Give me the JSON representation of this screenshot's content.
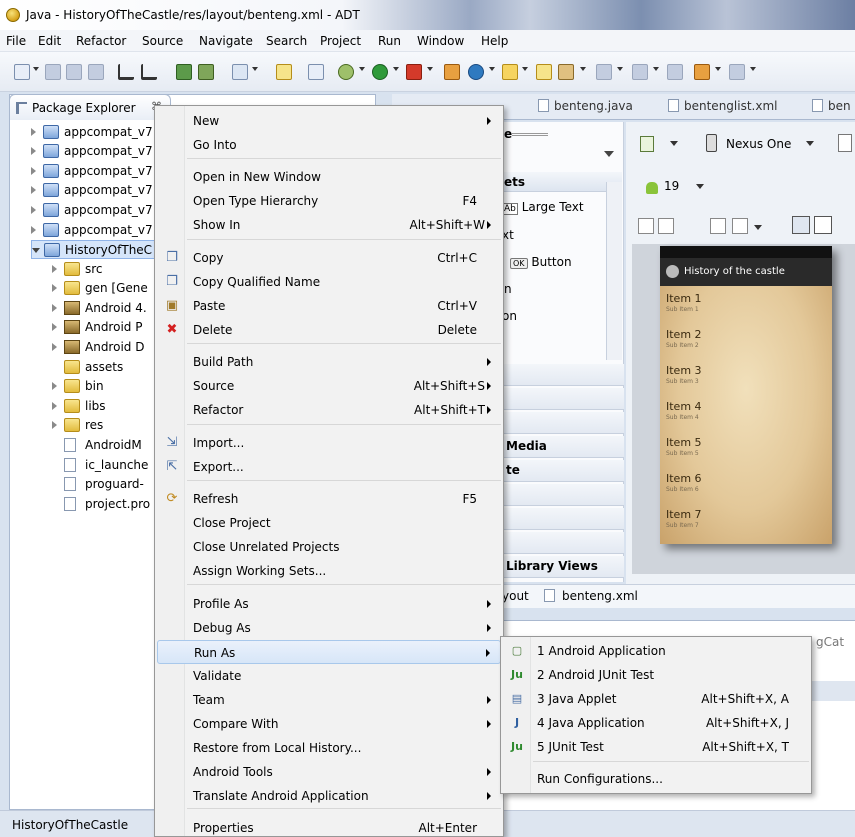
{
  "window": {
    "title": "Java - HistoryOfTheCastle/res/layout/benteng.xml - ADT"
  },
  "menubar": [
    "File",
    "Edit",
    "Refactor",
    "Source",
    "Navigate",
    "Search",
    "Project",
    "Run",
    "Window",
    "Help"
  ],
  "package_explorer": {
    "tab_label": "Package Explorer",
    "close_glyph": "⌘",
    "rows": [
      {
        "label": "appcompat_v7",
        "kind": "project"
      },
      {
        "label": "appcompat_v7",
        "kind": "project"
      },
      {
        "label": "appcompat_v7",
        "kind": "project"
      },
      {
        "label": "appcompat_v7",
        "kind": "project"
      },
      {
        "label": "appcompat_v7",
        "kind": "project"
      },
      {
        "label": "appcompat_v7",
        "kind": "project"
      },
      {
        "label": "HistoryOfTheC",
        "kind": "project"
      },
      {
        "label": "src",
        "kind": "pkgfolder"
      },
      {
        "label": "gen [Gene",
        "kind": "pkgfolder"
      },
      {
        "label": "Android 4.",
        "kind": "lib"
      },
      {
        "label": "Android P",
        "kind": "lib"
      },
      {
        "label": "Android D",
        "kind": "lib"
      },
      {
        "label": "assets",
        "kind": "folder"
      },
      {
        "label": "bin",
        "kind": "folder"
      },
      {
        "label": "libs",
        "kind": "folder"
      },
      {
        "label": "res",
        "kind": "folder"
      },
      {
        "label": "AndroidM",
        "kind": "file"
      },
      {
        "label": "ic_launche",
        "kind": "file"
      },
      {
        "label": "proguard-",
        "kind": "file"
      },
      {
        "label": "project.pro",
        "kind": "file"
      }
    ]
  },
  "editor_tabs": [
    "benteng.java",
    "bentenglist.xml",
    "ben"
  ],
  "designer": {
    "device": "Nexus One",
    "api_level": "19",
    "palette_items": [
      "Large Text",
      "Button"
    ],
    "palette_fragments": [
      "e",
      "ets",
      "xt",
      "n",
      "on"
    ],
    "palette_sections": [
      "Media",
      "te",
      "Library Views"
    ],
    "phone": {
      "app_title": "History of the castle",
      "items": [
        {
          "title": "Item 1",
          "sub": "Sub Item 1"
        },
        {
          "title": "Item 2",
          "sub": "Sub Item 2"
        },
        {
          "title": "Item 3",
          "sub": "Sub Item 3"
        },
        {
          "title": "Item 4",
          "sub": "Sub Item 4"
        },
        {
          "title": "Item 5",
          "sub": "Sub Item 5"
        },
        {
          "title": "Item 6",
          "sub": "Sub Item 6"
        },
        {
          "title": "Item 7",
          "sub": "Sub Item 7"
        }
      ]
    },
    "bottom_tabs": [
      "yout",
      "benteng.xml"
    ],
    "console_tab_fragment": "gCat"
  },
  "context_menu": {
    "items": [
      {
        "label": "New",
        "submenu": true
      },
      {
        "label": "Go Into"
      },
      {
        "label": "Open in New Window"
      },
      {
        "label": "Open Type Hierarchy",
        "shortcut": "F4"
      },
      {
        "label": "Show In",
        "shortcut": "Alt+Shift+W",
        "submenu": true
      },
      {
        "label": "Copy",
        "shortcut": "Ctrl+C",
        "icon": "copy-icon"
      },
      {
        "label": "Copy Qualified Name",
        "icon": "copy-qualified-icon"
      },
      {
        "label": "Paste",
        "shortcut": "Ctrl+V",
        "icon": "paste-icon"
      },
      {
        "label": "Delete",
        "shortcut": "Delete",
        "icon": "delete-icon"
      },
      {
        "label": "Build Path",
        "submenu": true
      },
      {
        "label": "Source",
        "shortcut": "Alt+Shift+S",
        "submenu": true
      },
      {
        "label": "Refactor",
        "shortcut": "Alt+Shift+T",
        "submenu": true
      },
      {
        "label": "Import...",
        "icon": "import-icon"
      },
      {
        "label": "Export...",
        "icon": "export-icon"
      },
      {
        "label": "Refresh",
        "shortcut": "F5",
        "icon": "refresh-icon"
      },
      {
        "label": "Close Project"
      },
      {
        "label": "Close Unrelated Projects"
      },
      {
        "label": "Assign Working Sets..."
      },
      {
        "label": "Profile As",
        "submenu": true
      },
      {
        "label": "Debug As",
        "submenu": true
      },
      {
        "label": "Run As",
        "submenu": true,
        "highlighted": true
      },
      {
        "label": "Validate"
      },
      {
        "label": "Team",
        "submenu": true
      },
      {
        "label": "Compare With",
        "submenu": true
      },
      {
        "label": "Restore from Local History..."
      },
      {
        "label": "Android Tools",
        "submenu": true
      },
      {
        "label": "Translate Android Application",
        "submenu": true
      },
      {
        "label": "Properties",
        "shortcut": "Alt+Enter"
      }
    ]
  },
  "run_as_submenu": {
    "items": [
      {
        "label": "1 Android Application",
        "icon": "android-app-icon"
      },
      {
        "label": "2 Android JUnit Test",
        "icon": "junit-icon"
      },
      {
        "label": "3 Java Applet",
        "shortcut": "Alt+Shift+X, A",
        "icon": "applet-icon"
      },
      {
        "label": "4 Java Application",
        "shortcut": "Alt+Shift+X, J",
        "icon": "java-app-icon"
      },
      {
        "label": "5 JUnit Test",
        "shortcut": "Alt+Shift+X, T",
        "icon": "junit-icon"
      },
      {
        "label": "Run Configurations..."
      }
    ]
  },
  "statusbar": {
    "text": "HistoryOfTheCastle"
  },
  "colors": {
    "highlight": "#d7e6f8",
    "delete_icon": "#d42020",
    "junit": "#2f8a2f"
  }
}
